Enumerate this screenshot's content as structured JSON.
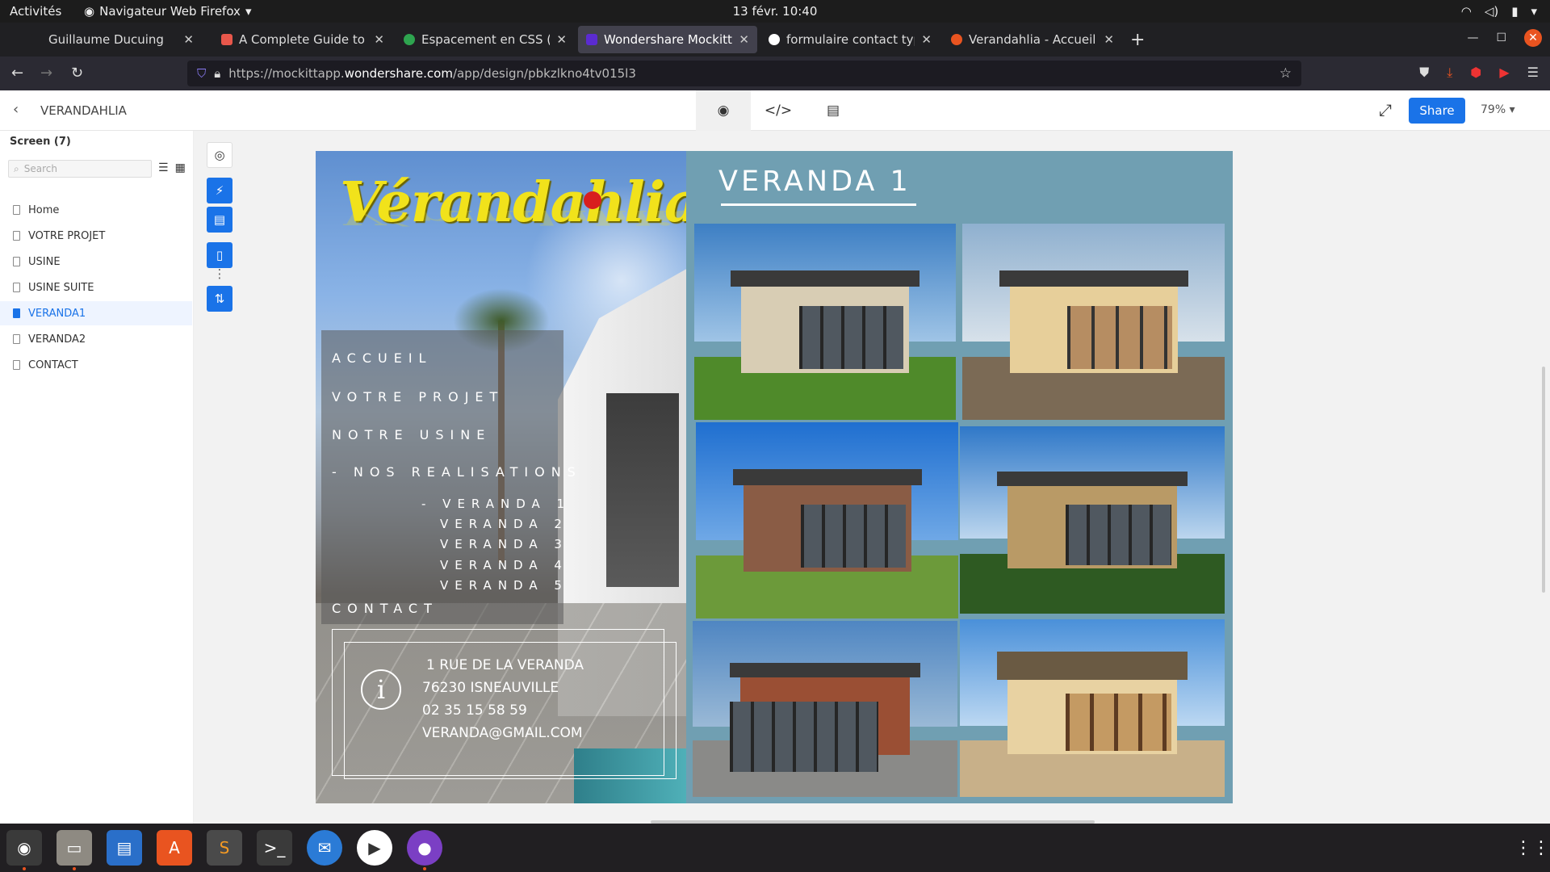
{
  "topbar": {
    "activities": "Activités",
    "app_menu": "Navigateur Web Firefox",
    "clock": "13 févr.  10:40"
  },
  "tabs": [
    {
      "title": "Guillaume Ducuing",
      "fav_color": "#202023"
    },
    {
      "title": "A Complete Guide to Flex",
      "fav_color": "#e8574b"
    },
    {
      "title": "Espacement en CSS (padd",
      "fav_color": "#2ea44f"
    },
    {
      "title": "Wondershare Mockitt - V",
      "fav_color": "#5b2bd1"
    },
    {
      "title": "formulaire contact type -",
      "fav_color": "#ffffff"
    },
    {
      "title": "Verandahlia - Accueil",
      "fav_color": "#e95420"
    }
  ],
  "nav": {
    "url_prefix": "https://mockittapp.",
    "url_domain": "wondershare.com",
    "url_path": "/app/design/pbkzlkno4tv015l3"
  },
  "app": {
    "project_name": "VERANDAHLIA",
    "share_label": "Share",
    "zoom": "79%"
  },
  "sidebar": {
    "header": "Screen  (7)",
    "search_placeholder": "Search",
    "pages": [
      "Home",
      "VOTRE PROJET",
      "USINE",
      "USINE SUITE",
      "VERANDA1",
      "VERANDA2",
      "CONTACT"
    ],
    "selected": "VERANDA1"
  },
  "mock": {
    "logo": "Vérandahlia",
    "menu": {
      "accueil": "ACCUEIL",
      "projet": "VOTRE PROJET",
      "usine": "NOTRE USINE",
      "realisations": "- NOS REALISATIONS",
      "sub": [
        "- VERANDA 1",
        "VERANDA 2",
        "VERANDA 3",
        "VERANDA 4",
        "VERANDA 5"
      ],
      "contact": "CONTACT"
    },
    "info_icon": "i",
    "address": [
      "1 RUE DE LA VERANDA",
      "76230 ISNEAUVILLE",
      "02 35 15 58 59",
      "VERANDA@GMAIL.COM"
    ],
    "title": "VERANDA 1"
  },
  "colors": {
    "accent": "#1a73e8",
    "right_panel": "#709fb2",
    "logo_yellow": "#f1e21b"
  },
  "icons": [
    "firefox-icon",
    "files-icon",
    "writer-icon",
    "software-icon",
    "sublime-icon",
    "terminal-icon",
    "thunderbird-icon",
    "player-icon",
    "github-icon"
  ]
}
